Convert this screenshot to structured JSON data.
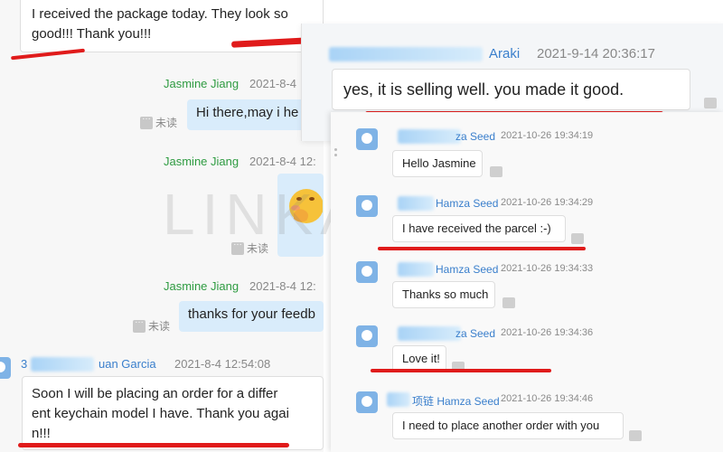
{
  "left_panel": {
    "msg_top": {
      "line1": "I received the package today. They look so",
      "line2": "good!!! Thank you!!!"
    },
    "entries": [
      {
        "sender": "Jasmine Jiang",
        "time": "2021-8-4",
        "unread": "未读",
        "text": "Hi there,may i he"
      },
      {
        "sender": "Jasmine Jiang",
        "time": "2021-8-4 12:",
        "unread": "未读"
      },
      {
        "sender": "Jasmine Jiang",
        "time": "2021-8-4 12:",
        "unread": "未读",
        "text": "thanks for your feedb"
      }
    ],
    "bottom": {
      "sender_prefix": "3",
      "sender_suffix": "uan Garcia",
      "time": "2021-8-4 12:54:08",
      "line1": "Soon I will be placing an order for a differ",
      "line2": "ent keychain model I have. Thank you agai",
      "line3": "n!!!"
    }
  },
  "watermark": "LINKAIZ",
  "topright": {
    "sender_suffix": "Araki",
    "time": "2021-9-14 20:36:17",
    "text": "yes, it is selling well. you made it good."
  },
  "bottomright": {
    "messages": [
      {
        "sender_suffix": "za Seed",
        "time": "2021-10-26 19:34:19",
        "text": "Hello Jasmine"
      },
      {
        "sender_suffix": "Hamza Seed",
        "time": "2021-10-26 19:34:29",
        "text": "I have received the parcel :-)"
      },
      {
        "sender_suffix": "Hamza Seed",
        "time": "2021-10-26 19:34:33",
        "text": "Thanks so much"
      },
      {
        "sender_suffix": "za Seed",
        "time": "2021-10-26 19:34:36",
        "text": "Love it!"
      },
      {
        "sender_suffix": "项链 Hamza Seed",
        "time": "2021-10-26 19:34:46",
        "text": "I need to place another order with you"
      }
    ]
  },
  "colors": {
    "sender_green": "#2e9b41",
    "sender_blue": "#3a7fcc",
    "highlight_red": "#e01b1b",
    "bubble_blue": "#d9ecfb"
  }
}
